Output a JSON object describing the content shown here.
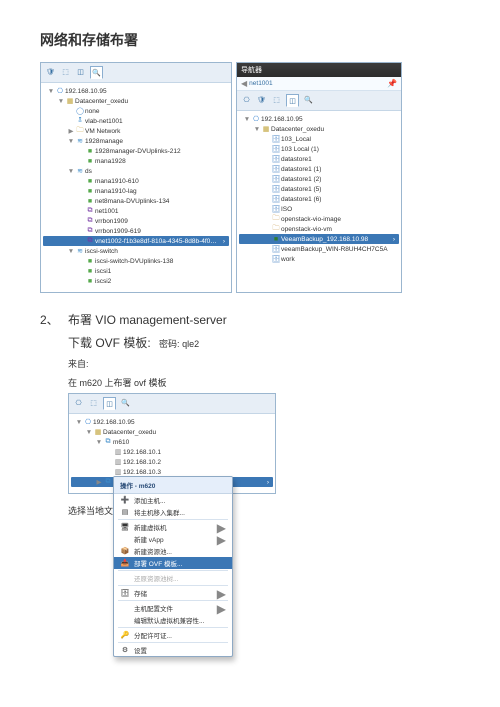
{
  "doc": {
    "title": "网络和存储布署",
    "stepNo": "2、",
    "stepText": "布署 VIO management-server",
    "downloadLabel": "下载 OVF 模板:",
    "pwdLabel": "密码:",
    "pwd": "qle2",
    "fromLabel": "来自:",
    "deployLine1": "在 m620 上布署 ovf 模板",
    "bottomLine": "选择当地文献"
  },
  "panelL": {
    "tabs": [
      "🛡",
      "⬚",
      "◫",
      "🔍"
    ],
    "activeTab": 3,
    "root": "192.168.10.95",
    "tree": [
      {
        "ind": 0,
        "tw": "▼",
        "ic": "icServer",
        "g": "⎔",
        "t": "192.168.10.95"
      },
      {
        "ind": 1,
        "tw": "▼",
        "ic": "icDC",
        "g": "▦",
        "t": "Datacenter_oxedu"
      },
      {
        "ind": 2,
        "tw": "",
        "ic": "icNone",
        "g": "◯",
        "t": "none"
      },
      {
        "ind": 2,
        "tw": "",
        "ic": "icSwitch",
        "g": "🕱",
        "t": "vlab-net1001"
      },
      {
        "ind": 2,
        "tw": "▶",
        "ic": "icFolder",
        "g": "🗀",
        "t": "VM Network"
      },
      {
        "ind": 2,
        "tw": "▼",
        "ic": "icSwitch",
        "g": "≋",
        "t": "1928manage"
      },
      {
        "ind": 3,
        "tw": "",
        "ic": "icPG",
        "g": "■",
        "t": "1928manager-DVUplinks-212"
      },
      {
        "ind": 3,
        "tw": "",
        "ic": "icPG",
        "g": "■",
        "t": "mana1928"
      },
      {
        "ind": 2,
        "tw": "▼",
        "ic": "icSwitch",
        "g": "≋",
        "t": "ds"
      },
      {
        "ind": 3,
        "tw": "",
        "ic": "icPG",
        "g": "■",
        "t": "mana1910-610"
      },
      {
        "ind": 3,
        "tw": "",
        "ic": "icPG",
        "g": "■",
        "t": "mana1910-lag"
      },
      {
        "ind": 3,
        "tw": "",
        "ic": "icPG",
        "g": "■",
        "t": "net8mana-DVUplinks-134"
      },
      {
        "ind": 3,
        "tw": "",
        "ic": "icVnet",
        "g": "⧉",
        "t": "net1001"
      },
      {
        "ind": 3,
        "tw": "",
        "ic": "icVnet",
        "g": "⧉",
        "t": "vrrbon1909"
      },
      {
        "ind": 3,
        "tw": "",
        "ic": "icVnet",
        "g": "⧉",
        "t": "vrrbon1909-619"
      },
      {
        "ind": 3,
        "tw": "",
        "ic": "icVnet",
        "g": "⧉",
        "t": "vnet1002-f1b3e8df-810a-4345-8d8b-4f0…",
        "sel": true
      },
      {
        "ind": 2,
        "tw": "▼",
        "ic": "icSwitch",
        "g": "≋",
        "t": "iscsi-switch"
      },
      {
        "ind": 3,
        "tw": "",
        "ic": "icPG",
        "g": "■",
        "t": "iscsi-switch-DVUplinks-138"
      },
      {
        "ind": 3,
        "tw": "",
        "ic": "icPG",
        "g": "■",
        "t": "iscsi1"
      },
      {
        "ind": 3,
        "tw": "",
        "ic": "icPG",
        "g": "■",
        "t": "iscsi2"
      }
    ]
  },
  "panelR": {
    "title": "导航器",
    "crumb": "net1001",
    "tabs": [
      "⎔",
      "🛡",
      "⬚",
      "◫",
      "🔍"
    ],
    "activeTab": 3,
    "tree": [
      {
        "ind": 0,
        "tw": "▼",
        "ic": "icServer",
        "g": "⎔",
        "t": "192.168.10.95"
      },
      {
        "ind": 1,
        "tw": "▼",
        "ic": "icDC",
        "g": "▦",
        "t": "Datacenter_oxedu"
      },
      {
        "ind": 2,
        "tw": "",
        "ic": "icDS",
        "g": "🗄",
        "t": "103_Local"
      },
      {
        "ind": 2,
        "tw": "",
        "ic": "icDS",
        "g": "🗄",
        "t": "103 Local (1)"
      },
      {
        "ind": 2,
        "tw": "",
        "ic": "icDS",
        "g": "🗄",
        "t": "datastore1"
      },
      {
        "ind": 2,
        "tw": "",
        "ic": "icDS",
        "g": "🗄",
        "t": "datastore1 (1)"
      },
      {
        "ind": 2,
        "tw": "",
        "ic": "icDS",
        "g": "🗄",
        "t": "datastore1 (2)"
      },
      {
        "ind": 2,
        "tw": "",
        "ic": "icDS",
        "g": "🗄",
        "t": "datastore1 (5)"
      },
      {
        "ind": 2,
        "tw": "",
        "ic": "icDS",
        "g": "🗄",
        "t": "datastore1 (6)"
      },
      {
        "ind": 2,
        "tw": "",
        "ic": "icDS",
        "g": "🗄",
        "t": "ISO"
      },
      {
        "ind": 2,
        "tw": "",
        "ic": "icBox",
        "g": "🗀",
        "t": "openstack-vio-image"
      },
      {
        "ind": 2,
        "tw": "",
        "ic": "icBox",
        "g": "🗀",
        "t": "openstack-vio-vm"
      },
      {
        "ind": 2,
        "tw": "",
        "ic": "icVeeam",
        "g": "■",
        "t": "VeeamBackup_192.168.10.98",
        "sel": true
      },
      {
        "ind": 2,
        "tw": "",
        "ic": "icDS",
        "g": "🗄",
        "t": "veeamBackup_WIN-R8UH4CH7C5A"
      },
      {
        "ind": 2,
        "tw": "",
        "ic": "icDS",
        "g": "🗄",
        "t": "work"
      }
    ]
  },
  "panel2": {
    "tabs": [
      "⎔",
      "⬚",
      "◫",
      "🔍"
    ],
    "activeTab": 2,
    "tree": [
      {
        "ind": 0,
        "tw": "▼",
        "ic": "icServer",
        "g": "⎔",
        "t": "192.168.10.95"
      },
      {
        "ind": 1,
        "tw": "▼",
        "ic": "icDC",
        "g": "▦",
        "t": "Datacenter_oxedu"
      },
      {
        "ind": 2,
        "tw": "▼",
        "ic": "icCluster",
        "g": "⧉",
        "t": "m610"
      },
      {
        "ind": 3,
        "tw": "",
        "ic": "icHost",
        "g": "▥",
        "t": "192.168.10.1"
      },
      {
        "ind": 3,
        "tw": "",
        "ic": "icHost",
        "g": "▥",
        "t": "192.168.10.2"
      },
      {
        "ind": 3,
        "tw": "",
        "ic": "icHost",
        "g": "▥",
        "t": "192.168.10.3"
      },
      {
        "ind": 2,
        "tw": "▶",
        "ic": "icCluster",
        "g": "⧉",
        "t": "m620",
        "sel": true
      }
    ]
  },
  "menu": {
    "header": "操作 - m620",
    "items": [
      {
        "ic": "➕",
        "t": "添加主机...",
        "sub": ""
      },
      {
        "ic": "▤",
        "t": "将主机移入集群...",
        "sub": ""
      },
      {
        "div": true
      },
      {
        "ic": "🖥",
        "t": "新建虚拟机",
        "sub": "▶"
      },
      {
        "ic": "",
        "t": "新建 vApp",
        "sub": "▶"
      },
      {
        "ic": "📦",
        "t": "新建资源池...",
        "sub": ""
      },
      {
        "ic": "📥",
        "t": "部署 OVF 模板...",
        "sub": "",
        "sel": true
      },
      {
        "div": true
      },
      {
        "ic": "",
        "t": "还原资源池树...",
        "sub": "",
        "disabled": true
      },
      {
        "div": true
      },
      {
        "ic": "🗄",
        "t": "存储",
        "sub": "▶"
      },
      {
        "div": true
      },
      {
        "ic": "",
        "t": "主机配置文件",
        "sub": "▶"
      },
      {
        "ic": "",
        "t": "编辑默认虚拟机兼容性...",
        "sub": ""
      },
      {
        "div": true
      },
      {
        "ic": "🔑",
        "t": "分配许可证...",
        "sub": ""
      },
      {
        "div": true
      },
      {
        "ic": "⚙",
        "t": "设置",
        "sub": ""
      }
    ]
  }
}
